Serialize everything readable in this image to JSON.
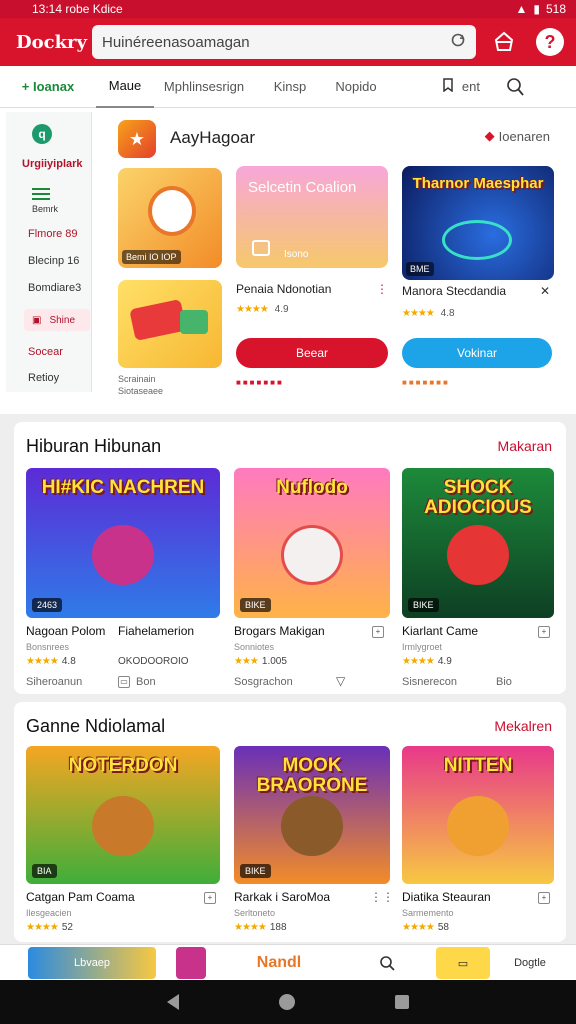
{
  "status_bar": {
    "left_text": "13:14 robe Kdice",
    "right_text": "518"
  },
  "header": {
    "logo": "Dockry",
    "search_value": "Huinéreenasoamagan",
    "colors": {
      "brand_red": "#d7142c"
    },
    "icons": [
      "basket-icon",
      "help-icon"
    ]
  },
  "tabs": [
    {
      "label": "+ Ioanax"
    },
    {
      "label": "Maue"
    },
    {
      "label": "Mphlinsesrign"
    },
    {
      "label": "Kinsp"
    },
    {
      "label": "Nopido"
    },
    {
      "label": "ent"
    }
  ],
  "side_menu": {
    "title": "Urgiiyiplark",
    "items": [
      "Bemrk",
      "Flmore 89",
      "Blecinp 16",
      "Bomdiare3",
      "Shine",
      "Socear",
      "Retioy"
    ]
  },
  "featured": {
    "title": "AayHagoar",
    "link": "Ioenaren",
    "tile1_label": "Bemi IO IOP",
    "promo_title": "Selcetin Coalion",
    "promo_sub": "Isono",
    "app1": {
      "name": "Penaia Ndonotian",
      "rating": "4.9",
      "stars": "★★★★",
      "button": "Beear"
    },
    "art3_title": "Tharnor Maesphar",
    "art3_badge": "BME",
    "app2": {
      "name": "Manora Stecdandia",
      "rating": "4.8",
      "stars": "★★★★",
      "button": "Vokinar"
    },
    "caption1": "Scrainain",
    "caption2": "Siotaseaee"
  },
  "section1": {
    "title": "Hiburan Hibunan",
    "more": "Makaran",
    "cards": [
      {
        "art_title": "HI#KIC NACHREN",
        "badge": "2463",
        "name": "Nagoan Polom",
        "dev": "Bonsnrees",
        "stars": "★★★★",
        "rating": "4.8",
        "meta_left": "Siheroanun",
        "meta_right": "Bon"
      },
      {
        "art_title": "Nuflodo",
        "badge": "BIKE",
        "name": "Brogars Makigan",
        "dev": "Sonniotes",
        "stars": "★★★",
        "rating": "1.005",
        "meta_left": "Sosgrachon",
        "meta_right": ""
      },
      {
        "art_title": "SHOCK ADIOCIOUS",
        "badge": "BIKE",
        "name": "Kiarlant Came",
        "dev": "Irmlygroet",
        "stars": "★★★★",
        "rating": "4.9",
        "meta_left": "Sisnerecon",
        "meta_right": "Bio"
      }
    ],
    "extra_names": [
      "Fiahelamerion"
    ],
    "extra_meta": "OKODOOROIO"
  },
  "section2": {
    "title": "Ganne Ndiolamal",
    "more": "Mekalren",
    "cards": [
      {
        "art_title": "NOTERDON",
        "badge": "BIA",
        "name": "Catgan Pam Coama",
        "dev": "Ilesgeacien",
        "stars": "★★★★",
        "rating": "52"
      },
      {
        "art_title": "MOOK BRAORONE",
        "badge": "BIKE",
        "name": "Rarkak i SaroMoa",
        "dev": "Serltoneto",
        "stars": "★★★★",
        "rating": "188"
      },
      {
        "art_title": "NITTEN",
        "badge": "",
        "name": "Diatika Steauran",
        "dev": "Sarmemento",
        "stars": "★★★★",
        "rating": "58"
      }
    ]
  },
  "bottom_strip": {
    "item1": "Lbvaep",
    "item3": "Nandl",
    "item5": "Dogtle"
  }
}
